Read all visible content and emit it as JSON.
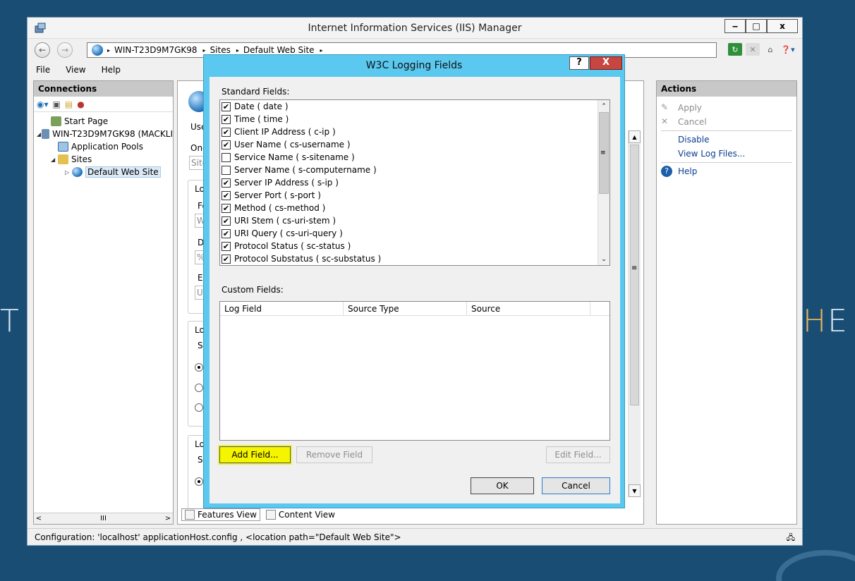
{
  "background": {
    "left_text": "T",
    "right_text_accent": "H",
    "right_text": "E"
  },
  "window": {
    "title": "Internet Information Services (IIS) Manager",
    "minimize": "‒",
    "maximize": "□",
    "close": "x"
  },
  "address": {
    "crumbs": [
      "WIN-T23D9M7GK98",
      "Sites",
      "Default Web Site"
    ],
    "separator": "▸"
  },
  "menu": [
    "File",
    "View",
    "Help"
  ],
  "connections": {
    "header": "Connections",
    "tree": [
      {
        "label": "Start Page",
        "level": 0,
        "toggle": ""
      },
      {
        "label": "WIN-T23D9M7GK98 (MACKLI",
        "level": 0,
        "toggle": "◢"
      },
      {
        "label": "Application Pools",
        "level": 1,
        "toggle": ""
      },
      {
        "label": "Sites",
        "level": 1,
        "toggle": "◢"
      },
      {
        "label": "Default Web Site",
        "level": 2,
        "toggle": "▷"
      }
    ],
    "scroll_thumb": "III"
  },
  "center_fragments": {
    "use": "Use",
    "one": "One",
    "site": "Site",
    "lo1": "Lo",
    "fo": "Fo",
    "w": "W",
    "di": "Di",
    "pct": "%",
    "en": "En",
    "u": "U",
    "lo2": "Lo",
    "se1": "Se",
    "lo3": "Lo",
    "se2": "Se"
  },
  "view_tabs": {
    "features": "Features View",
    "content": "Content View"
  },
  "actions": {
    "header": "Actions",
    "apply": "Apply",
    "cancel": "Cancel",
    "disable": "Disable",
    "view_log_files": "View Log Files...",
    "help": "Help"
  },
  "status": "Configuration: 'localhost' applicationHost.config , <location path=\"Default Web Site\">",
  "dialog": {
    "title": "W3C Logging Fields",
    "help_btn": "?",
    "close_btn": "X",
    "standard_label": "Standard Fields:",
    "standard_fields": [
      {
        "label": "Date ( date )",
        "checked": true
      },
      {
        "label": "Time ( time )",
        "checked": true
      },
      {
        "label": "Client IP Address ( c-ip )",
        "checked": true
      },
      {
        "label": "User Name ( cs-username )",
        "checked": true
      },
      {
        "label": "Service Name ( s-sitename )",
        "checked": false
      },
      {
        "label": "Server Name ( s-computername )",
        "checked": false
      },
      {
        "label": "Server IP Address ( s-ip )",
        "checked": true
      },
      {
        "label": "Server Port ( s-port )",
        "checked": true
      },
      {
        "label": "Method ( cs-method )",
        "checked": true
      },
      {
        "label": "URI Stem ( cs-uri-stem )",
        "checked": true
      },
      {
        "label": "URI Query ( cs-uri-query )",
        "checked": true
      },
      {
        "label": "Protocol Status ( sc-status )",
        "checked": true
      },
      {
        "label": "Protocol Substatus ( sc-substatus )",
        "checked": true
      }
    ],
    "custom_label": "Custom Fields:",
    "custom_columns": [
      "Log Field",
      "Source Type",
      "Source"
    ],
    "add_field": "Add Field...",
    "remove_field": "Remove Field",
    "edit_field": "Edit Field...",
    "ok": "OK",
    "cancel": "Cancel"
  },
  "colors": {
    "desktop": "#1a4d73",
    "dialog_frame": "#5ac8ef",
    "close_red": "#c74642",
    "highlight_yellow": "#f5f500",
    "link_blue": "#0a3e90"
  }
}
